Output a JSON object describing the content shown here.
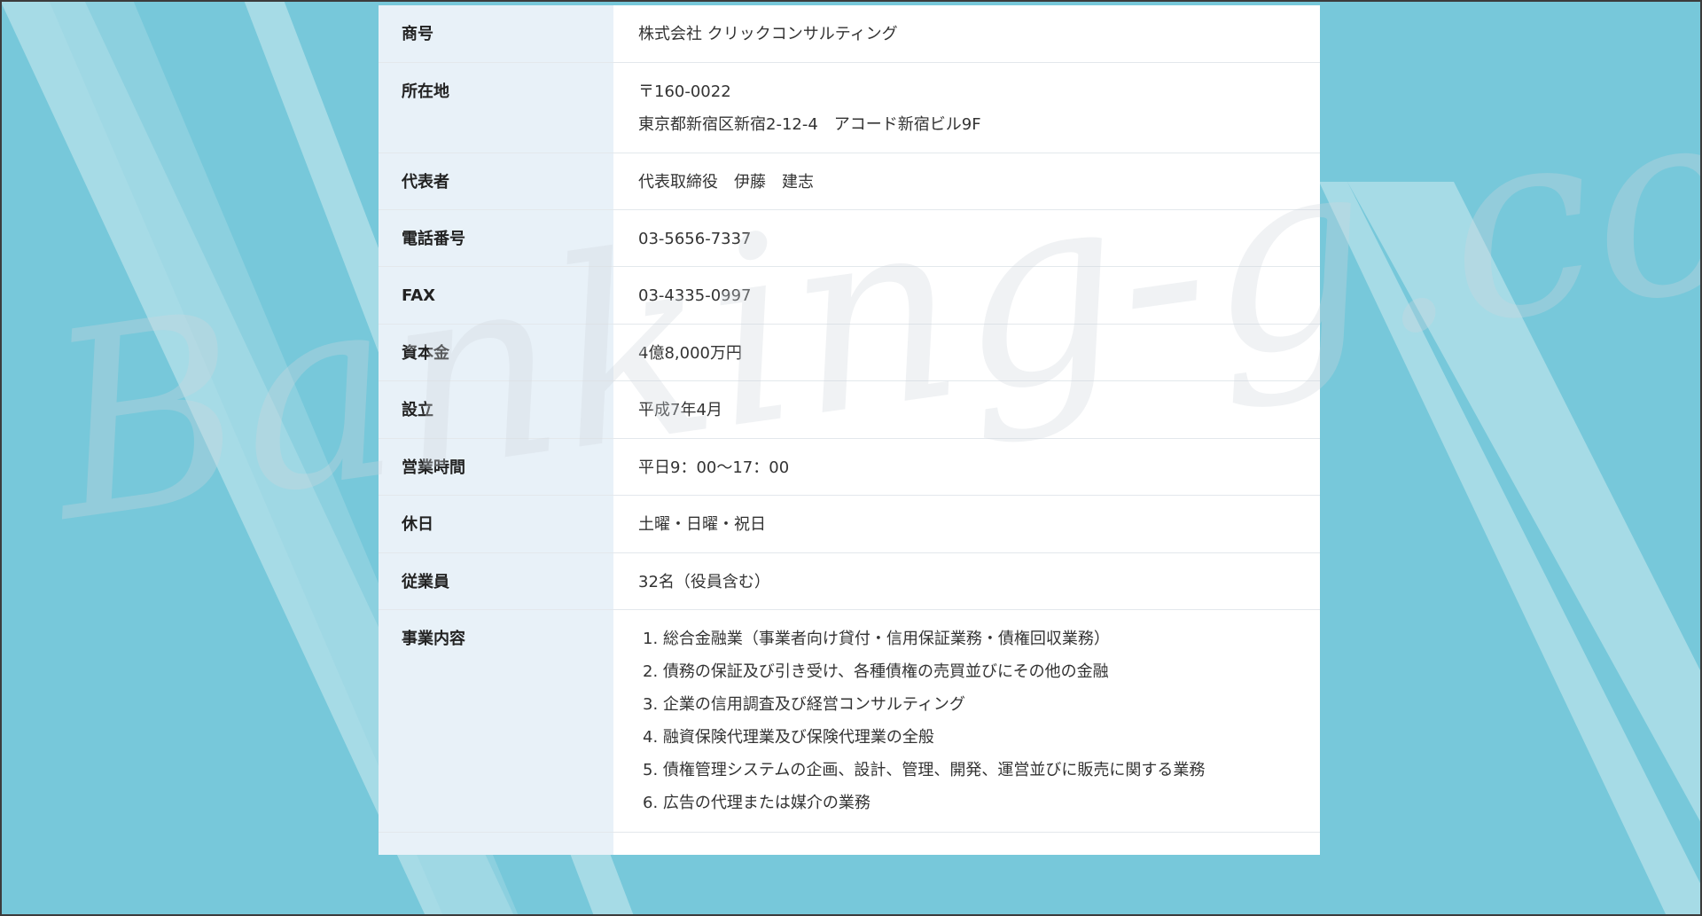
{
  "page": {
    "background_color": "#77c8da",
    "stripe_color": "#a6dbe6",
    "label_column_color": "#e8f1f8"
  },
  "watermark": {
    "text": "Banking-g.com"
  },
  "company_info": {
    "rows": [
      {
        "label": "商号",
        "values": [
          "株式会社 クリックコンサルティング"
        ]
      },
      {
        "label": "所在地",
        "values": [
          "〒160-0022",
          "東京都新宿区新宿2-12-4　アコード新宿ビル9F"
        ]
      },
      {
        "label": "代表者",
        "values": [
          "代表取締役　伊藤　建志"
        ]
      },
      {
        "label": "電話番号",
        "values": [
          "03-5656-7337"
        ]
      },
      {
        "label": "FAX",
        "values": [
          "03-4335-0997"
        ]
      },
      {
        "label": "資本金",
        "values": [
          "4億8,000万円"
        ]
      },
      {
        "label": "設立",
        "values": [
          "平成7年4月"
        ]
      },
      {
        "label": "営業時間",
        "values": [
          "平日9：00〜17：00"
        ]
      },
      {
        "label": "休日",
        "values": [
          "土曜・日曜・祝日"
        ]
      },
      {
        "label": "従業員",
        "values": [
          "32名（役員含む）"
        ]
      }
    ],
    "business": {
      "label": "事業内容",
      "items": [
        "1. 総合金融業（事業者向け貸付・信用保証業務・債権回収業務）",
        "2. 債務の保証及び引き受け、各種債権の売買並びにその他の金融",
        "3. 企業の信用調査及び経営コンサルティング",
        "4. 融資保険代理業及び保険代理業の全般",
        "5. 債権管理システムの企画、設計、管理、開発、運営並びに販売に関する業務",
        "6. 広告の代理または媒介の業務"
      ]
    }
  }
}
